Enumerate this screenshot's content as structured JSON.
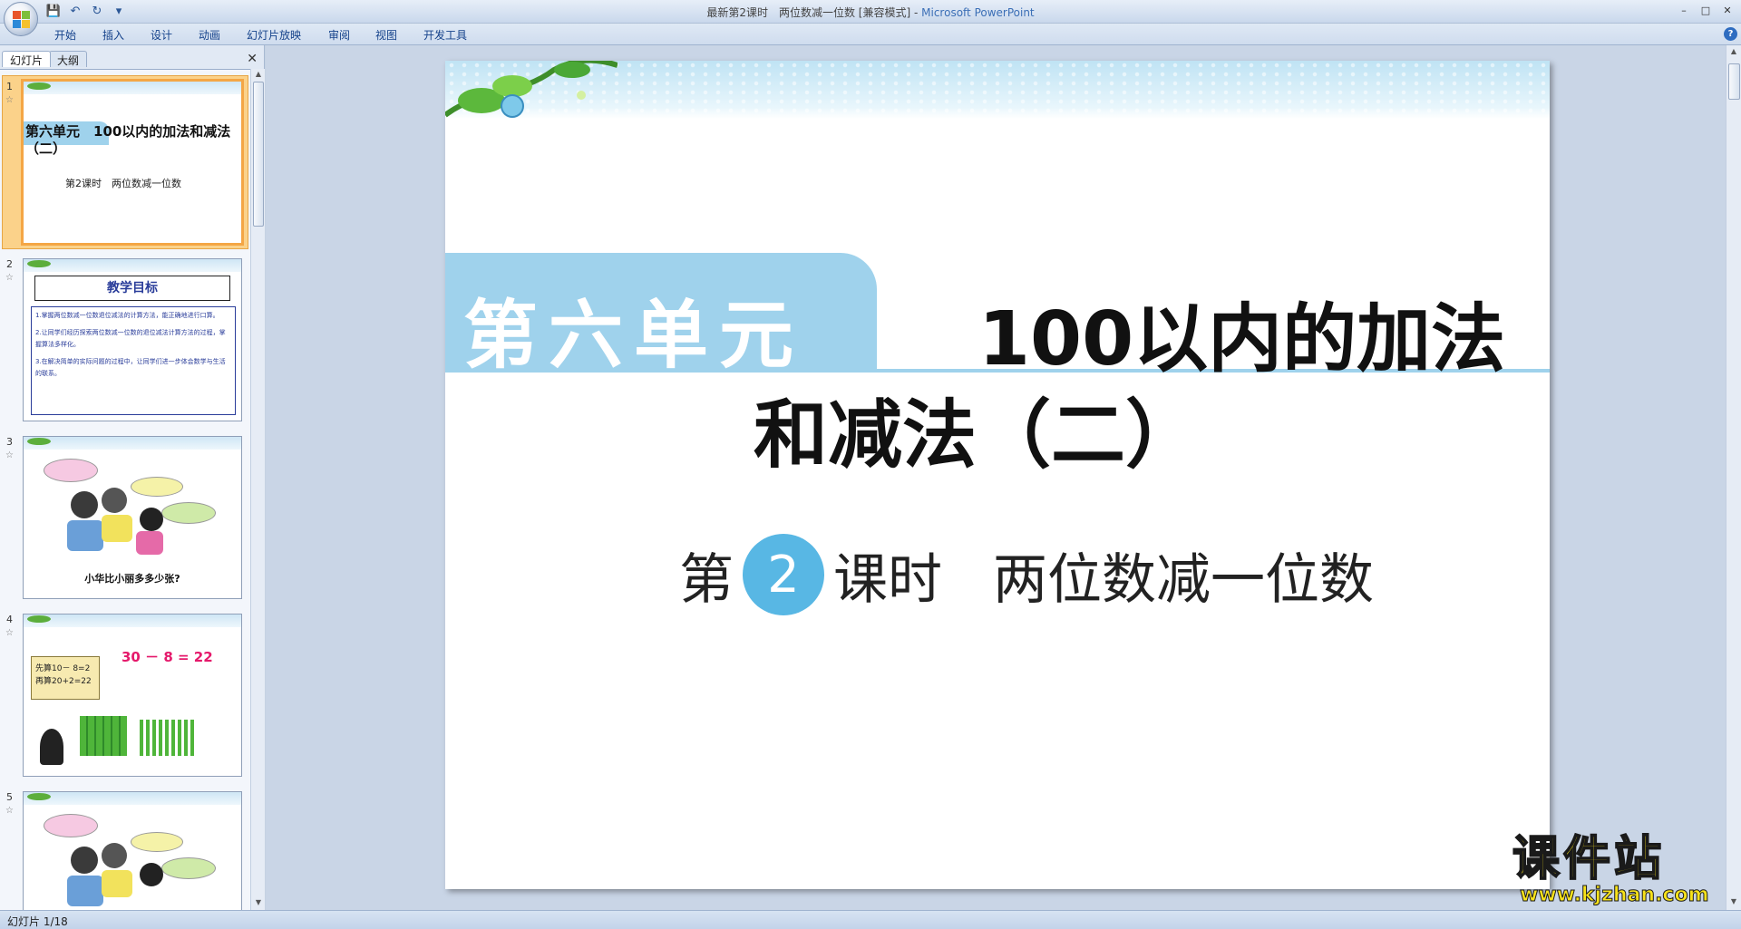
{
  "window": {
    "title": "最新第2课时　两位数减一位数 [兼容模式] - ",
    "app_name": "Microsoft PowerPoint",
    "controls": [
      "–",
      "□",
      "✕"
    ]
  },
  "qat": {
    "save_icon": "💾",
    "undo_icon": "↶",
    "redo_icon": "↻",
    "more_icon": "▾"
  },
  "ribbon": {
    "tabs": [
      "开始",
      "插入",
      "设计",
      "动画",
      "幻灯片放映",
      "审阅",
      "视图",
      "开发工具"
    ],
    "help": "?"
  },
  "left_pane": {
    "tabs": [
      "幻灯片",
      "大纲"
    ],
    "close": "✕",
    "thumbnails": [
      {
        "num": "1",
        "title": "第六单元　100以内的加法和减法（二）",
        "subtitle": "第2课时　两位数减一位数"
      },
      {
        "num": "2",
        "title": "教学目标",
        "lines": [
          "1.掌握两位数减一位数退位减法的计算方法，能正确地进行口算。",
          "2.让同学们经历探索两位数减一位数的退位减法计算方法的过程，掌握算法多样化。",
          "3.在解决简单的实际问题的过程中，让同学们进一步体会数学与生活的联系。"
        ]
      },
      {
        "num": "3",
        "caption": "小华比小丽多多少张?"
      },
      {
        "num": "4",
        "equation": "30 － 8 = 22",
        "note1": "先算10－ 8=2",
        "note2": "再算20+2=22"
      },
      {
        "num": "5"
      }
    ]
  },
  "slide": {
    "unit": "第六单元",
    "title_line1": "100以内的加法",
    "title_line2": "和减法（二）",
    "lesson_prefix": "第",
    "lesson_number": "2",
    "lesson_suffix": "课时",
    "lesson_topic": "两位数减一位数"
  },
  "watermark": {
    "cn": "课件站",
    "en": "www.kjzhan.com"
  },
  "status": {
    "slide_info": "幻灯片 1/18"
  },
  "colors": {
    "accent_blue": "#9fd2ec",
    "circle_blue": "#58b7e4",
    "selection_orange": "#f4a645"
  }
}
